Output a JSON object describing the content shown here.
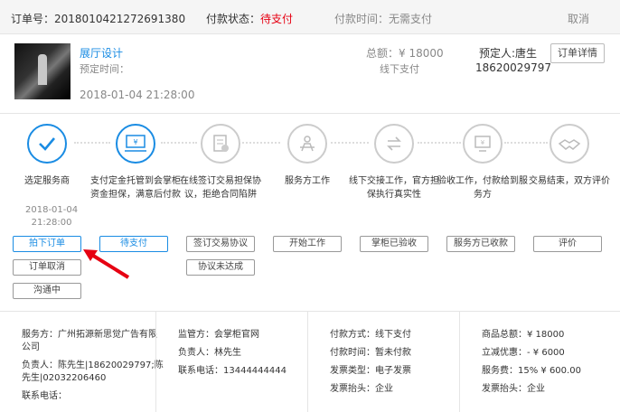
{
  "header": {
    "order_no_label": "订单号：",
    "order_no": "2018010421272691380",
    "pay_status_label": "付款状态：",
    "pay_status": "待支付",
    "pay_time_label": "付款时间：",
    "pay_time": "无需支付",
    "cancel_label": "取消"
  },
  "order": {
    "title": "展厅设计",
    "reserve_time_label": "预定时间：",
    "date": "2018-01-04 21:28:00",
    "total_label": "总额：",
    "total": "¥ 18000",
    "pay_method": "线下支付",
    "booker_label": "预定人:",
    "booker": "唐生",
    "phone": "18620029797",
    "detail_button": "订单详情"
  },
  "steps": [
    {
      "label": "选定服务商",
      "icon": "check-icon"
    },
    {
      "label": "支付定金托管到会掌柜资金担保，满意后付款",
      "icon": "money-card-icon"
    },
    {
      "label": "在线签订交易担保协议，拒绝合同陷阱",
      "icon": "document-check-icon"
    },
    {
      "label": "服务方工作",
      "icon": "worker-desk-icon"
    },
    {
      "label": "线下交接工作，官方担保执行真实性",
      "icon": "exchange-arrows-icon"
    },
    {
      "label": "验收工作，付款给到服务方",
      "icon": "payment-screen-icon"
    },
    {
      "label": "交易结束，双方评价",
      "icon": "handshake-icon"
    }
  ],
  "step_time": {
    "date": "2018-01-04",
    "time": "21:28:00"
  },
  "step_buttons": {
    "accept_order": "拍下订单",
    "cancel_order": "订单取消",
    "communicating": "沟通中",
    "pending_payment": "待支付",
    "sign_agreement": "签订交易协议",
    "agreement_failed": "协议未达成",
    "start_work": "开始工作",
    "manager_accept": "掌柜已验收",
    "provider_received": "服务方已收款",
    "review": "评价"
  },
  "bottom": {
    "provider": {
      "label": "服务方：",
      "name_line1": "广州拓源新思觉广告有限",
      "name_line2": "公司",
      "contact_label": "负责人：",
      "contact_line1": "陈先生|18620029797;陈",
      "contact_line2": "先生|02032206460",
      "phone_label": "联系电话："
    },
    "supervisor": {
      "label": "监管方：",
      "name": "会掌柜官网",
      "contact_label": "负责人：",
      "contact": "林先生",
      "phone_label": "联系电话：",
      "phone": "13444444444"
    },
    "payment": {
      "method_label": "付款方式：",
      "method": "线下支付",
      "time_label": "付款时间：",
      "time": "暂未付款",
      "invoice_type_label": "发票类型：",
      "invoice_type": "电子发票",
      "invoice_title_label": "发票抬头：",
      "invoice_title": "企业"
    },
    "summary": {
      "total_label": "商品总额：",
      "total": "¥ 18000",
      "discount_label": "立减优惠：",
      "discount": "- ¥ 6000",
      "fee_label": "服务费：",
      "fee": "15%  ¥ 600.00",
      "invoice_title_label": "发票抬头：",
      "invoice_title": "企业"
    }
  },
  "colors": {
    "accent": "#1a8ce3",
    "alert": "#e60012",
    "arrow": "#e60012"
  }
}
